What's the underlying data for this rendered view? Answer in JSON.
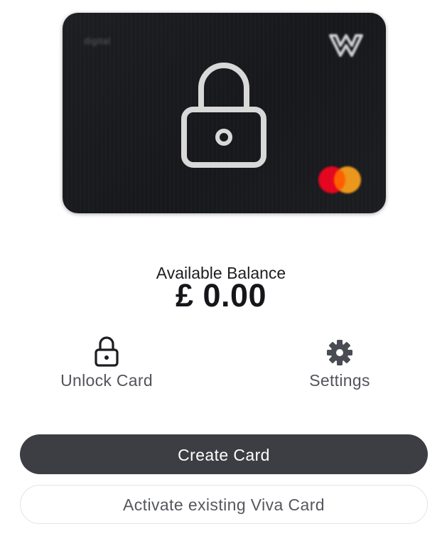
{
  "card": {
    "type_label": "digital",
    "status": "locked",
    "logo_icon": "viva-logo-icon",
    "network_icon": "mastercard-icon",
    "lock_icon": "padlock-icon"
  },
  "balance": {
    "label": "Available Balance",
    "value": "£ 0.00"
  },
  "actions": {
    "unlock_card": {
      "label": "Unlock Card",
      "icon": "lock-icon"
    },
    "settings": {
      "label": "Settings",
      "icon": "gear-icon"
    }
  },
  "buttons": {
    "create_card": "Create Card",
    "activate_existing": "Activate existing Viva Card"
  },
  "colors": {
    "card_background": "#1a1b1f",
    "primary_button": "#3d3e43",
    "secondary_text": "#55575e",
    "mastercard_red": "#eb001b",
    "mastercard_orange": "#f79e1b"
  }
}
